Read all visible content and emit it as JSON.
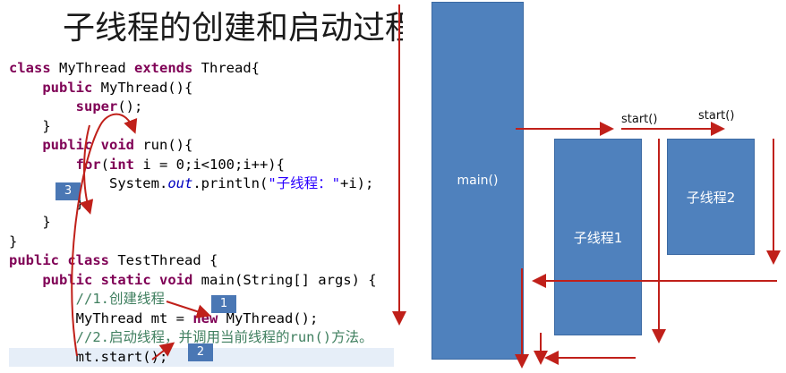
{
  "title": "子线程的创建和启动过程",
  "code": {
    "lines": [
      [
        {
          "t": "class ",
          "c": "kw"
        },
        {
          "t": "MyThread "
        },
        {
          "t": "extends ",
          "c": "kw"
        },
        {
          "t": "Thread{"
        }
      ],
      [
        {
          "t": "    "
        },
        {
          "t": "public ",
          "c": "kw"
        },
        {
          "t": "MyThread(){"
        }
      ],
      [
        {
          "t": "        "
        },
        {
          "t": "super",
          "c": "kw"
        },
        {
          "t": "();"
        }
      ],
      [
        {
          "t": "    }"
        }
      ],
      [
        {
          "t": "    "
        },
        {
          "t": "public ",
          "c": "kw"
        },
        {
          "t": "void ",
          "c": "kw"
        },
        {
          "t": "run(){"
        }
      ],
      [
        {
          "t": "        "
        },
        {
          "t": "for",
          "c": "kw"
        },
        {
          "t": "("
        },
        {
          "t": "int ",
          "c": "kw"
        },
        {
          "t": "i = 0;i<100;i++){"
        }
      ],
      [
        {
          "t": "            System."
        },
        {
          "t": "out",
          "c": "it"
        },
        {
          "t": ".println("
        },
        {
          "t": "\"子线程：\"",
          "c": "st"
        },
        {
          "t": "+i);"
        }
      ],
      [
        {
          "t": "        }"
        }
      ],
      [
        {
          "t": "    }"
        }
      ],
      [
        {
          "t": "}"
        }
      ],
      [
        {
          "t": "public ",
          "c": "kw"
        },
        {
          "t": "class ",
          "c": "kw"
        },
        {
          "t": "TestThread {"
        }
      ],
      [
        {
          "t": "    "
        },
        {
          "t": "public ",
          "c": "kw"
        },
        {
          "t": "static ",
          "c": "kw"
        },
        {
          "t": "void ",
          "c": "kw"
        },
        {
          "t": "main(String[] args) {"
        }
      ],
      [
        {
          "t": "        "
        },
        {
          "t": "//1.创建线程",
          "c": "cm"
        }
      ],
      [
        {
          "t": "        MyThread mt = "
        },
        {
          "t": "new ",
          "c": "kw"
        },
        {
          "t": "MyThread();"
        }
      ],
      [
        {
          "t": "        "
        },
        {
          "t": "//2.启动线程，并调用当前线程的run()方法。",
          "c": "cm"
        }
      ],
      [
        {
          "t": "        mt.start();"
        }
      ]
    ],
    "highlight_line": 15
  },
  "badges": {
    "b1": "1",
    "b2": "2",
    "b3": "3"
  },
  "diagram": {
    "main_label": "main()",
    "thread1_label": "子线程1",
    "thread2_label": "子线程2",
    "start1_label": "start()",
    "start2_label": "start()"
  },
  "colors": {
    "box": "#4f81bd",
    "arrow": "#c0201a",
    "badge": "#4a77b4"
  }
}
